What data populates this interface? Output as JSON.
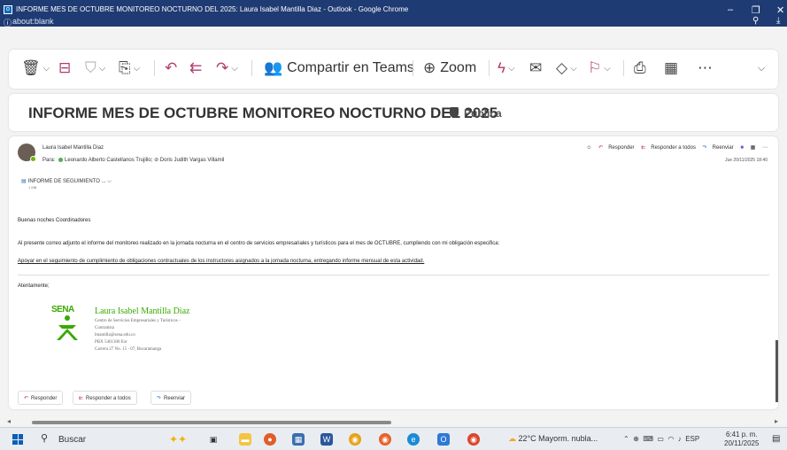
{
  "window": {
    "title": "INFORME MES DE OCTUBRE MONITOREO NOCTURNO DEL 2025: Laura Isabel Mantilla Diaz - Outlook - Google Chrome",
    "url": "about:blank"
  },
  "ribbon": {
    "teams_label": "Compartir en Teams",
    "zoom_label": "Zoom"
  },
  "subject": {
    "text": "INFORME MES DE OCTUBRE  MONITOREO NOCTURNO  DEL 2025",
    "visibility": "Pública"
  },
  "message": {
    "sender": "Laura Isabel Mantilla Diaz",
    "to_label": "Para:",
    "to_1": "Leonardo Alberto Castellanos Trujillo;",
    "to_2": "Doris Judith Vargas Villamil",
    "reply": "Responder",
    "reply_all": "Responder a todos",
    "forward": "Reenviar",
    "date": "Jue 20/11/2025 18:40",
    "attachment_name": "INFORME DE SEGUIMIENTO ...",
    "attachment_size": "1 MB",
    "greeting": "Buenas noches  Coordinadores",
    "paragraph": "Al presente correo adjunto el informe del monitoreo realizado en la jornada nocturna en el centro de servicios empresariales y turísticos para el mes de OCTUBRE, cumpliendo con mi obligación especifica:",
    "obligation": "Apoyar en el seguimiento de cumplimiento de obligaciones contractuales de los instructores asignados a la jornada nocturna, entregando informe mensual de esta actividad.",
    "closing": "Atentamente;"
  },
  "signature": {
    "logo_text": "SENA",
    "name": "Laura Isabel Mantilla Diaz",
    "line1": "Centro de Servicios Empresariales y Turísticos -",
    "line2": "Contratista",
    "line3": "lmantilla@sena.edu.co",
    "line4": "PBX 5461300 Ext",
    "line5": "Carrera 27 No. 15 - 07, Bucaramanga"
  },
  "footer_buttons": {
    "reply": "Responder",
    "reply_all": "Responder a todos",
    "forward": "Reenviar"
  },
  "taskbar": {
    "search_label": "Buscar",
    "weather": "22°C  Mayorm. nubla...",
    "lang": "ESP",
    "time": "6:41 p. m.",
    "date": "20/11/2025"
  }
}
